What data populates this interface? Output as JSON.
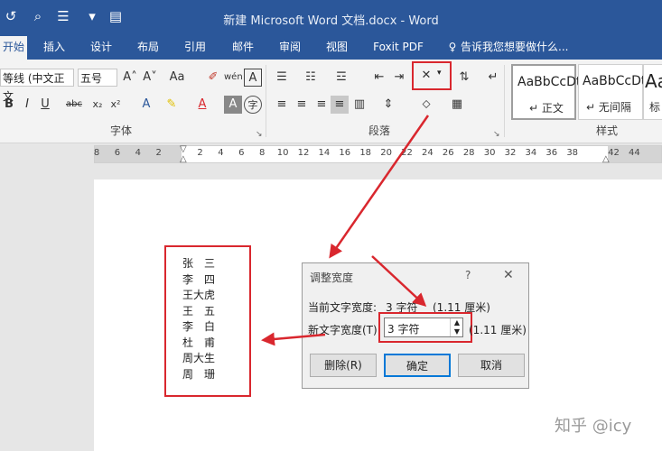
{
  "window": {
    "title": "新建 Microsoft Word 文档.docx - Word"
  },
  "tabs": [
    {
      "label": "开始"
    },
    {
      "label": "插入"
    },
    {
      "label": "设计"
    },
    {
      "label": "布局"
    },
    {
      "label": "引用"
    },
    {
      "label": "邮件"
    },
    {
      "label": "审阅"
    },
    {
      "label": "视图"
    },
    {
      "label": "Foxit PDF"
    },
    {
      "label": "告诉我您想要做什么..."
    }
  ],
  "font": {
    "name": "等线 (中文正文",
    "size": "五号",
    "group_label": "字体"
  },
  "paragraph": {
    "group_label": "段落"
  },
  "styles": {
    "group_label": "样式",
    "items": [
      {
        "sample": "AaBbCcDt",
        "name": "↵ 正文"
      },
      {
        "sample": "AaBbCcDt",
        "name": "↵ 无间隔"
      },
      {
        "sample": "Aa",
        "name": "标"
      }
    ]
  },
  "ruler": {
    "numbers": [
      "8",
      "6",
      "4",
      "2",
      "",
      "2",
      "4",
      "6",
      "8",
      "10",
      "12",
      "14",
      "16",
      "18",
      "20",
      "22",
      "24",
      "26",
      "28",
      "30",
      "32",
      "34",
      "36",
      "38",
      "",
      "42",
      "44"
    ]
  },
  "document": {
    "names": [
      "张　三",
      "李　四",
      "王大虎",
      "王　五",
      "李　白",
      "杜　甫",
      "周大生",
      "周　珊"
    ]
  },
  "dialog": {
    "title": "调整宽度",
    "help": "?",
    "close": "✕",
    "current_label": "当前文字宽度:",
    "current_value": "3 字符",
    "current_cm": "(1.11 厘米)",
    "new_label": "新文字宽度(T):",
    "new_value": "3 字符",
    "new_cm": "(1.11 厘米)",
    "delete_button": "删除(R)",
    "ok_button": "确定",
    "cancel_button": "取消"
  },
  "watermark": "知乎 @icy",
  "colors": {
    "accent": "#2b579a",
    "highlight_red": "#d9272e"
  }
}
